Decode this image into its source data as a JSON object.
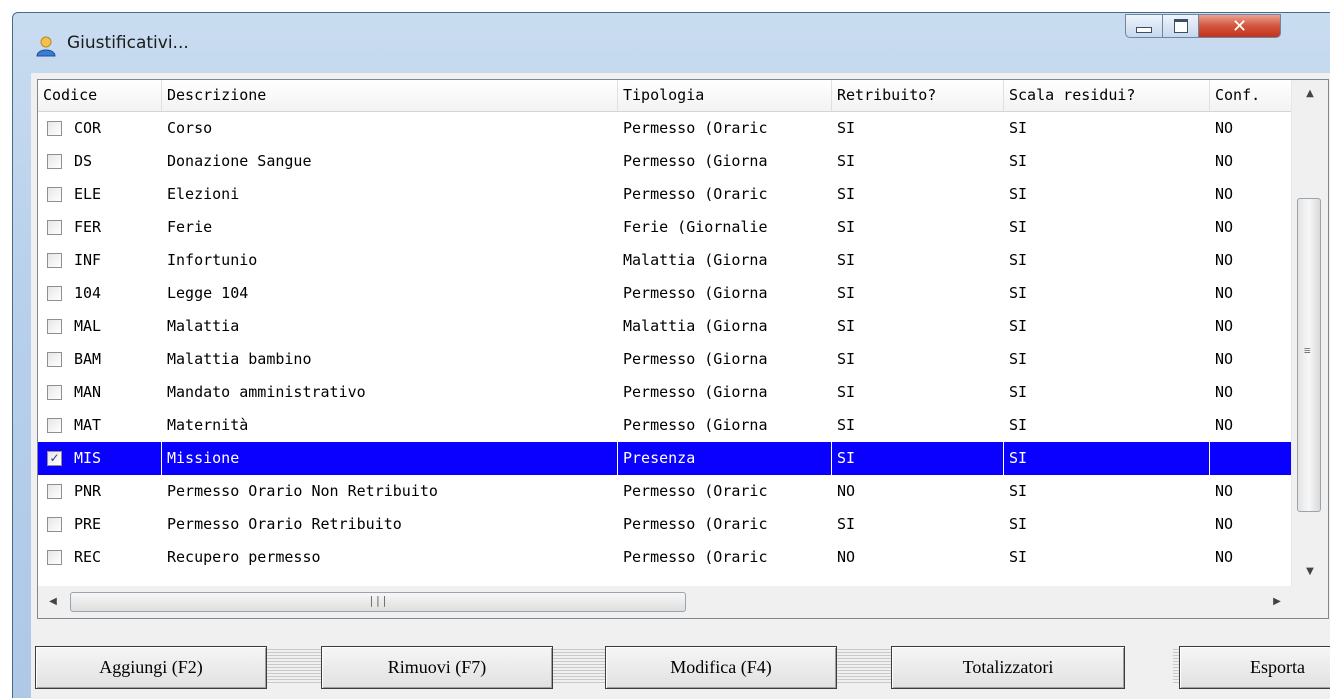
{
  "window": {
    "title": "Giustificativi..."
  },
  "columns": [
    "Codice",
    "Descrizione",
    "Tipologia",
    "Retribuito?",
    "Scala residui?",
    "Conf."
  ],
  "rows": [
    {
      "code": "COR",
      "desc": "Corso",
      "tipo": "Permesso (Oraric",
      "retr": "SI",
      "scala": "SI",
      "conf": "NO",
      "checked": false,
      "selected": false
    },
    {
      "code": "DS",
      "desc": "Donazione Sangue",
      "tipo": "Permesso (Giorna",
      "retr": "SI",
      "scala": "SI",
      "conf": "NO",
      "checked": false,
      "selected": false
    },
    {
      "code": "ELE",
      "desc": "Elezioni",
      "tipo": "Permesso (Oraric",
      "retr": "SI",
      "scala": "SI",
      "conf": "NO",
      "checked": false,
      "selected": false
    },
    {
      "code": "FER",
      "desc": "Ferie",
      "tipo": "Ferie (Giornalie",
      "retr": "SI",
      "scala": "SI",
      "conf": "NO",
      "checked": false,
      "selected": false
    },
    {
      "code": "INF",
      "desc": "Infortunio",
      "tipo": "Malattia (Giorna",
      "retr": "SI",
      "scala": "SI",
      "conf": "NO",
      "checked": false,
      "selected": false
    },
    {
      "code": "104",
      "desc": "Legge 104",
      "tipo": "Permesso (Giorna",
      "retr": "SI",
      "scala": "SI",
      "conf": "NO",
      "checked": false,
      "selected": false
    },
    {
      "code": "MAL",
      "desc": "Malattia",
      "tipo": "Malattia (Giorna",
      "retr": "SI",
      "scala": "SI",
      "conf": "NO",
      "checked": false,
      "selected": false
    },
    {
      "code": "BAM",
      "desc": "Malattia bambino",
      "tipo": "Permesso (Giorna",
      "retr": "SI",
      "scala": "SI",
      "conf": "NO",
      "checked": false,
      "selected": false
    },
    {
      "code": "MAN",
      "desc": "Mandato amministrativo",
      "tipo": "Permesso (Giorna",
      "retr": "SI",
      "scala": "SI",
      "conf": "NO",
      "checked": false,
      "selected": false
    },
    {
      "code": "MAT",
      "desc": "Maternità",
      "tipo": "Permesso (Giorna",
      "retr": "SI",
      "scala": "SI",
      "conf": "NO",
      "checked": false,
      "selected": false
    },
    {
      "code": "MIS",
      "desc": "Missione",
      "tipo": "Presenza",
      "retr": "SI",
      "scala": "SI",
      "conf": "",
      "checked": true,
      "selected": true
    },
    {
      "code": "PNR",
      "desc": "Permesso Orario Non Retribuito",
      "tipo": "Permesso (Oraric",
      "retr": "NO",
      "scala": "SI",
      "conf": "NO",
      "checked": false,
      "selected": false
    },
    {
      "code": "PRE",
      "desc": "Permesso Orario Retribuito",
      "tipo": "Permesso (Oraric",
      "retr": "SI",
      "scala": "SI",
      "conf": "NO",
      "checked": false,
      "selected": false
    },
    {
      "code": "REC",
      "desc": "Recupero permesso",
      "tipo": "Permesso (Oraric",
      "retr": "NO",
      "scala": "SI",
      "conf": "NO",
      "checked": false,
      "selected": false
    }
  ],
  "buttons": [
    "Aggiungi (F2)",
    "Rimuovi (F7)",
    "Modifica (F4)",
    "Totalizzatori",
    "Esporta"
  ],
  "colors": {
    "selection": "#0a00ff",
    "close": "#c4321b"
  }
}
